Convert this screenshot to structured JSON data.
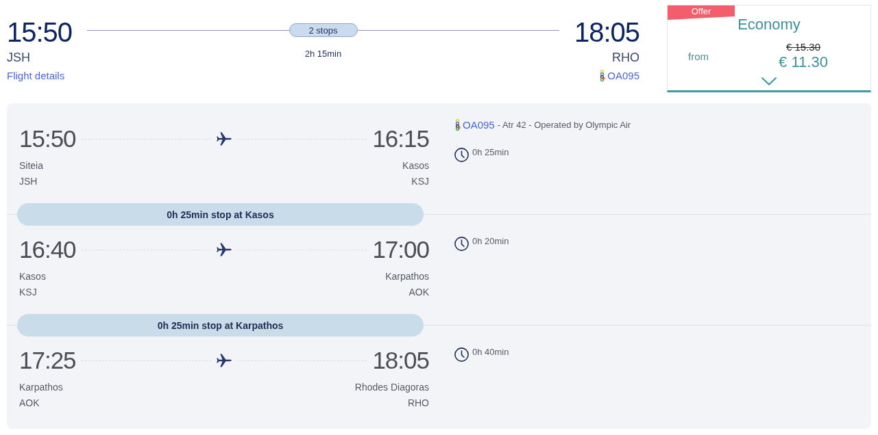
{
  "summary": {
    "departure": {
      "time": "15:50",
      "airport": "JSH"
    },
    "details_link": "Flight details",
    "stops": "2 stops",
    "duration": "2h 15min",
    "arrival": {
      "time": "18:05",
      "airport": "RHO"
    },
    "flight_number": "OA095"
  },
  "fare": {
    "badge": "Offer",
    "cabin": "Economy",
    "from_label": "from",
    "old_price": "€ 15.30",
    "price": "€ 11.30"
  },
  "segments": [
    {
      "departure": {
        "time": "15:50",
        "city": "Siteia",
        "code": "JSH"
      },
      "arrival": {
        "time": "16:15",
        "city": "Kasos",
        "code": "KSJ"
      },
      "flight_info": {
        "flight_number": "OA095",
        "details": "- Atr 42 - Operated by Olympic Air"
      },
      "duration": "0h 25min",
      "layover": "0h 25min stop at Kasos"
    },
    {
      "departure": {
        "time": "16:40",
        "city": "Kasos",
        "code": "KSJ"
      },
      "arrival": {
        "time": "17:00",
        "city": "Karpathos",
        "code": "AOK"
      },
      "duration": "0h 20min",
      "layover": "0h 25min stop at Karpathos"
    },
    {
      "departure": {
        "time": "17:25",
        "city": "Karpathos",
        "code": "AOK"
      },
      "arrival": {
        "time": "18:05",
        "city": "Rhodes Diagoras",
        "code": "RHO"
      },
      "duration": "0h 40min"
    }
  ]
}
